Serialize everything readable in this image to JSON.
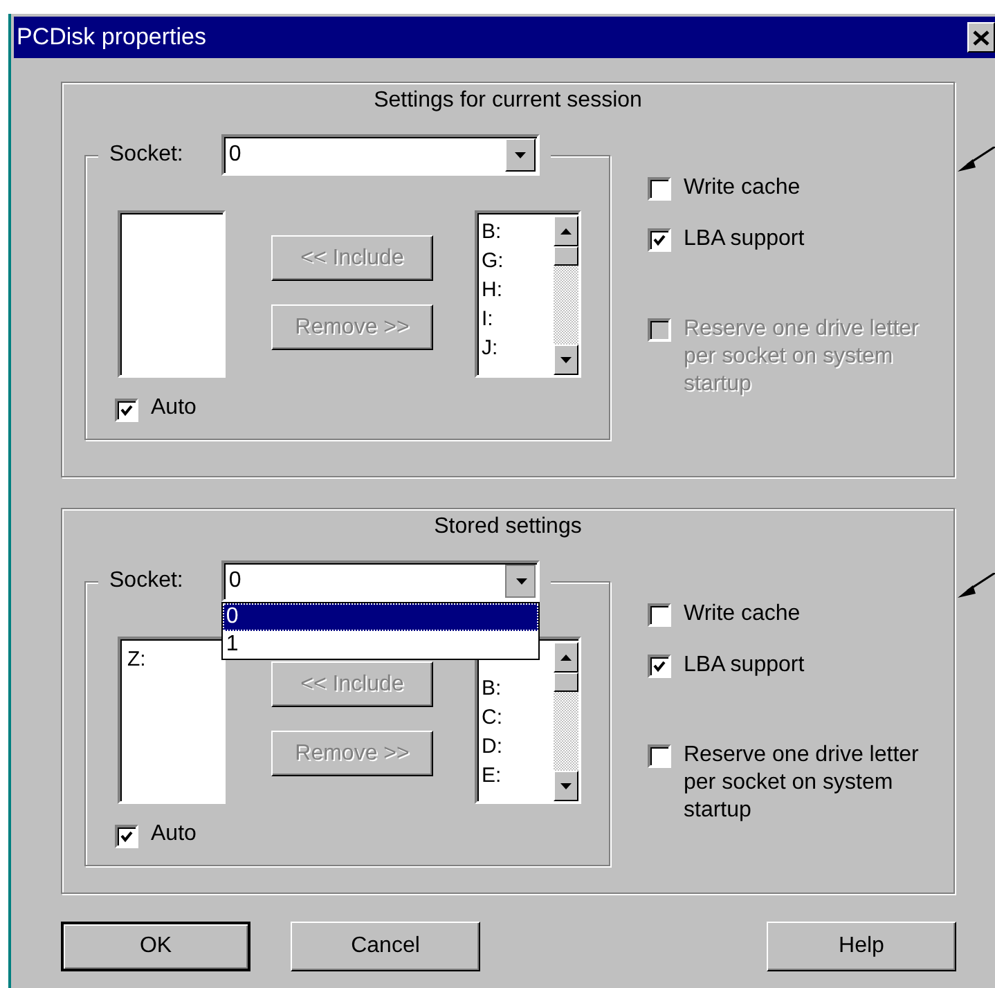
{
  "window": {
    "title": "PCDisk properties"
  },
  "groups": [
    {
      "title": "Settings for current session",
      "socket_label": "Socket:",
      "socket_value": "0",
      "socket_open": false,
      "include_button": {
        "label": "<< Include",
        "disabled": true
      },
      "remove_button": {
        "label": "Remove >>",
        "disabled": true
      },
      "available_drives": [
        "B:",
        "G:",
        "H:",
        "I:",
        "J:"
      ],
      "auto": {
        "label": "Auto",
        "checked": true
      },
      "options_right": [
        {
          "label": "Write cache",
          "checked": false,
          "disabled": false
        },
        {
          "label": "LBA support",
          "checked": true,
          "disabled": false
        },
        {
          "label": "Reserve one drive letter per socket on system startup",
          "checked": false,
          "disabled": true
        }
      ]
    },
    {
      "title": "Stored settings",
      "socket_label": "Socket:",
      "socket_value": "0",
      "socket_open": true,
      "options": [
        {
          "label": "0",
          "selected": true
        },
        {
          "label": "1",
          "selected": false
        }
      ],
      "assigned_drives": [
        "Z:"
      ],
      "include_button": {
        "label": "<< Include",
        "disabled": true
      },
      "remove_button": {
        "label": "Remove >>",
        "disabled": true
      },
      "available_drives": [
        "B:",
        "C:",
        "D:",
        "E:"
      ],
      "auto": {
        "label": "Auto",
        "checked": true
      },
      "options_right": [
        {
          "label": "Write cache",
          "checked": false,
          "disabled": false
        },
        {
          "label": "LBA support",
          "checked": true,
          "disabled": false
        },
        {
          "label": "Reserve one drive letter per socket on system startup",
          "checked": false,
          "disabled": false
        }
      ]
    }
  ],
  "buttons": [
    {
      "label": "OK"
    },
    {
      "label": "Cancel"
    },
    {
      "label": "Help"
    }
  ]
}
